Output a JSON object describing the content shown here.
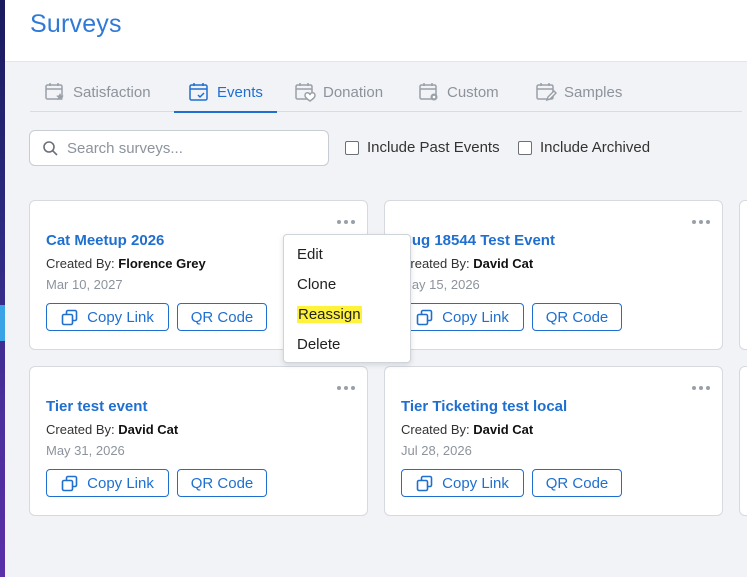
{
  "header": {
    "title": "Surveys"
  },
  "tabs": [
    {
      "label": "Satisfaction",
      "icon": "calendar-star-icon",
      "active": false
    },
    {
      "label": "Events",
      "icon": "calendar-check-icon",
      "active": true
    },
    {
      "label": "Donation",
      "icon": "calendar-heart-icon",
      "active": false
    },
    {
      "label": "Custom",
      "icon": "calendar-gear-icon",
      "active": false
    },
    {
      "label": "Samples",
      "icon": "calendar-edit-icon",
      "active": false
    }
  ],
  "search": {
    "placeholder": "Search surveys...",
    "value": ""
  },
  "filters": [
    {
      "label": "Include Past Events",
      "checked": false
    },
    {
      "label": "Include Archived",
      "checked": false
    }
  ],
  "cards": [
    {
      "title": "Cat Meetup 2026",
      "created_label": "Created By:",
      "creator": "Florence Grey",
      "date": "Mar 10, 2027",
      "copy_label": "Copy Link",
      "qr_label": "QR Code"
    },
    {
      "title": "Bug 18544 Test Event",
      "created_label": "Created By:",
      "creator": "David Cat",
      "date": "May 15, 2026",
      "copy_label": "Copy Link",
      "qr_label": "QR Code"
    },
    {
      "title": "Tier test event",
      "created_label": "Created By:",
      "creator": "David Cat",
      "date": "May 31, 2026",
      "copy_label": "Copy Link",
      "qr_label": "QR Code"
    },
    {
      "title": "Tier Ticketing test local",
      "created_label": "Created By:",
      "creator": "David Cat",
      "date": "Jul 28, 2026",
      "copy_label": "Copy Link",
      "qr_label": "QR Code"
    }
  ],
  "context_menu": {
    "items": [
      "Edit",
      "Clone",
      "Reassign",
      "Delete"
    ],
    "highlighted": "Reassign"
  },
  "colors": {
    "accent": "#1f6fd0",
    "title": "#2e7ad6",
    "highlight": "#fff23a"
  }
}
